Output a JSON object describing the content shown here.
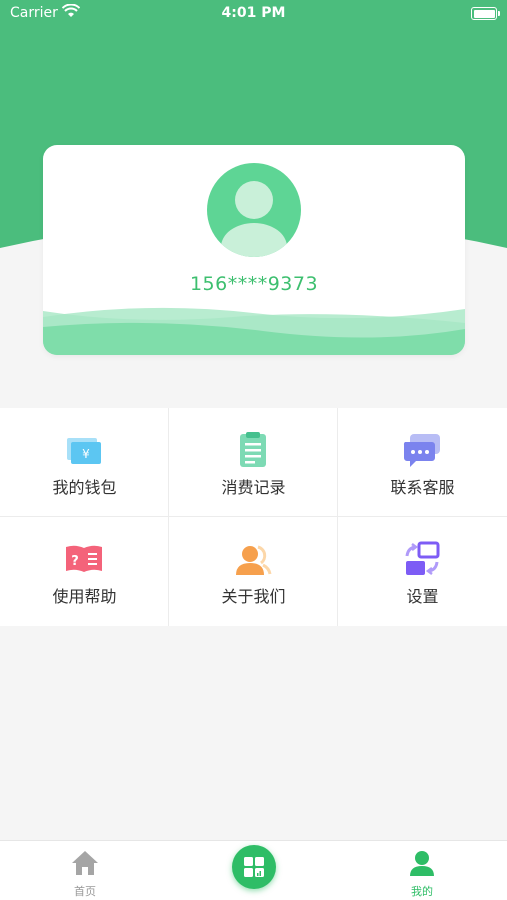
{
  "status_bar": {
    "carrier": "Carrier",
    "time": "4:01 PM"
  },
  "profile": {
    "phone": "156****9373"
  },
  "menu": [
    {
      "label": "我的钱包",
      "icon": "wallet-icon"
    },
    {
      "label": "消费记录",
      "icon": "clipboard-icon"
    },
    {
      "label": "联系客服",
      "icon": "chat-icon"
    },
    {
      "label": "使用帮助",
      "icon": "help-book-icon"
    },
    {
      "label": "关于我们",
      "icon": "about-users-icon"
    },
    {
      "label": "设置",
      "icon": "settings-swap-icon"
    }
  ],
  "tab_bar": {
    "home_label": "首页",
    "mine_label": "我的",
    "center_icon": "grid-chart-icon"
  },
  "colors": {
    "primary_green": "#4bbd7d",
    "accent_green": "#2ebd66",
    "text_dark": "#333333",
    "inactive_tab": "#999999"
  }
}
